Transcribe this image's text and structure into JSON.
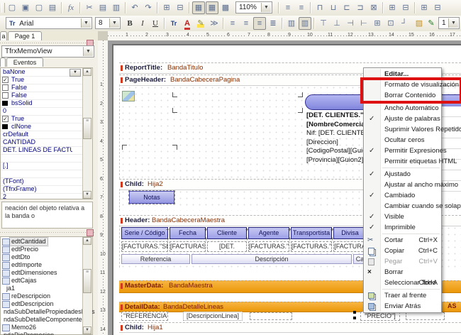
{
  "toolbar": {
    "zoom_value": "110%",
    "line_width": "1"
  },
  "format_bar": {
    "font_name": "Arial",
    "font_size": "8",
    "bold": "B",
    "italic": "I",
    "underline": "U"
  },
  "tabs": {
    "partial_tab": "a",
    "page_tab": "Page 1"
  },
  "inspector": {
    "object_selector": "TfrxMemoView",
    "events_tab": "Eventos",
    "properties": [
      "baNone",
      "True",
      "False",
      "False",
      "bsSolid",
      "0",
      "True",
      "clNone",
      "crDefault",
      "CANTIDAD",
      "DET. LINEAS DE FACTURAS",
      "",
      "[.]",
      "",
      "(TFont)",
      "(TfrxFrame)",
      "2"
    ],
    "hint": "neación del objeto relativa a la banda o",
    "tree_items": [
      "edtCantidad",
      "edtPrecio",
      "edtDto",
      "edtImporte",
      "edtDimensiones",
      "edtCajas",
      "ja1",
      "reDescripcion",
      "edtDescripcion",
      "ndaSubDetallePropiedadesFijas",
      "ndaSubDetalleComponentes",
      "Memo26",
      "ndaPiePromocion"
    ]
  },
  "rulers": {
    "h": [
      "1",
      "2",
      "3",
      "4",
      "5",
      "6",
      "7",
      "8",
      "9",
      "10",
      "11",
      "12",
      "13",
      "14",
      "15",
      "16",
      "17"
    ],
    "v": [
      "1",
      "2",
      "3",
      "4",
      "5",
      "6",
      "7",
      "8",
      "9",
      "10",
      "11",
      "12",
      "13",
      "14"
    ]
  },
  "report": {
    "bands": [
      {
        "type": "ReportTitle:",
        "name": "BandaTitulo"
      },
      {
        "type": "PageHeader:",
        "name": "BandaCabeceraPagina"
      },
      {
        "type": "Child:",
        "name": "Hija2"
      },
      {
        "type": "Header:",
        "name": "BandaCabeceraMaestra"
      },
      {
        "type": "MasterData:",
        "name": "BandaMaestra"
      },
      {
        "type": "DetailData:",
        "name": "BandaDetalleLineas"
      },
      {
        "type": "Child:",
        "name": "Hija1"
      }
    ],
    "notas_label": "Notas",
    "client_lines": [
      "[DET. CLIENTES.\"E",
      "[NombreComercial]",
      "Nif: [DET. CLIENTES",
      "[Direccion]",
      "[CodigoPostal][Guion",
      "[Provincia][Guion2][P"
    ],
    "header_cells": [
      "Serie / Código",
      "Fecha",
      "Cliente",
      "Agente",
      "Transportista",
      "Divisa"
    ],
    "field_cells": [
      "[FACTURAS.\"SE",
      "[FACTURAS.\"F",
      "[DET.",
      "[FACTURAS.\"P",
      "[FACTURAS.\"P",
      "[FACTURA"
    ],
    "ref_cells": [
      "Referencia",
      "Descripción",
      "Ca"
    ],
    "detail_cells": [
      "\"REFERENCIA\"]",
      "[DescripcionLinea]",
      "\"PRECIO\"]"
    ],
    "band_right_fragment": "AS"
  },
  "context_menu": {
    "items": [
      {
        "label": "Editar...",
        "shortcut": ""
      },
      {
        "label": "Formato de visualización...",
        "shortcut": ""
      },
      {
        "label": "Borrar Contenido",
        "shortcut": ""
      },
      {
        "label": "Ancho Automático",
        "shortcut": ""
      },
      {
        "label": "Ajuste de palabras",
        "shortcut": ""
      },
      {
        "label": "Suprimir Valores Repetidos",
        "shortcut": ""
      },
      {
        "label": "Ocultar ceros",
        "shortcut": ""
      },
      {
        "label": "Permitir Expresiones",
        "shortcut": ""
      },
      {
        "label": "Permitir etiquetas HTML",
        "shortcut": ""
      },
      {
        "label": "Ajustado",
        "shortcut": ""
      },
      {
        "label": "Ajustar al ancho máximo",
        "shortcut": ""
      },
      {
        "label": "Cambiado",
        "shortcut": ""
      },
      {
        "label": "Cambiar cuando se solape",
        "shortcut": ""
      },
      {
        "label": "Visible",
        "shortcut": ""
      },
      {
        "label": "Imprimible",
        "shortcut": ""
      },
      {
        "label": "Cortar",
        "shortcut": "Ctrl+X"
      },
      {
        "label": "Copiar",
        "shortcut": "Ctrl+C"
      },
      {
        "label": "Pegar",
        "shortcut": "Ctrl+V"
      },
      {
        "label": "Borrar",
        "shortcut": ""
      },
      {
        "label": "Seleccionar Todo",
        "shortcut": "Ctrl+A"
      },
      {
        "label": "Traer al frente",
        "shortcut": ""
      },
      {
        "label": "Enviar Atrás",
        "shortcut": ""
      }
    ]
  },
  "colors": {
    "accent_orange": "#eb9709",
    "band_purple": "#9da0e8",
    "highlight_red": "#dd1111",
    "value_navy": "#00007f"
  }
}
